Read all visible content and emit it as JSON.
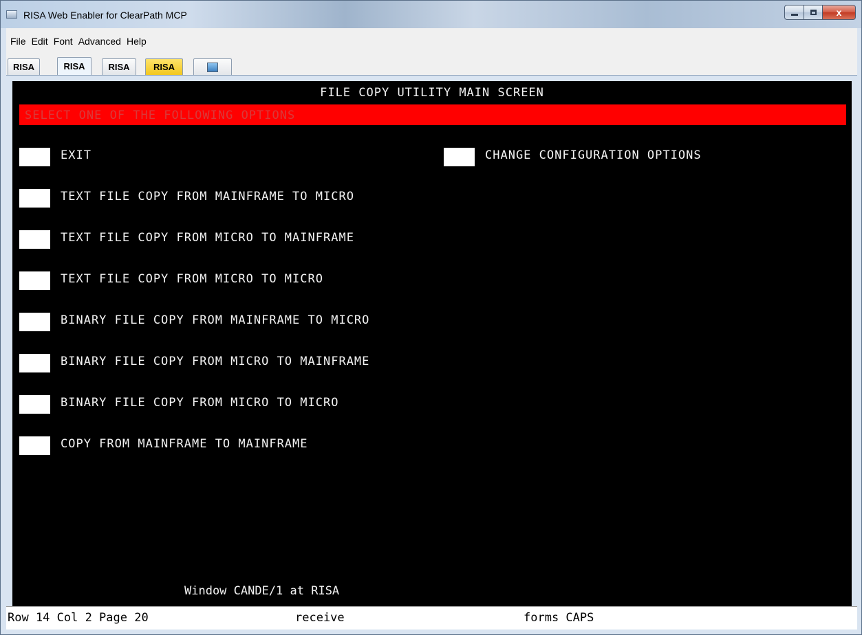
{
  "window": {
    "title": "RISA Web Enabler for ClearPath MCP",
    "close_glyph": "x"
  },
  "menu": {
    "items": [
      "File",
      "Edit",
      "Font",
      "Advanced",
      "Help"
    ]
  },
  "tabs": [
    {
      "label": "RISA",
      "state": "normal"
    },
    {
      "label": "RISA",
      "state": "active"
    },
    {
      "label": "RISA",
      "state": "normal"
    },
    {
      "label": "RISA",
      "state": "highlighted",
      "color": "#f5cc2a"
    },
    {
      "label": "",
      "icon": "terminal-icon"
    }
  ],
  "screen": {
    "title": "FILE COPY UTILITY MAIN SCREEN",
    "prompt": "SELECT ONE OF THE FOLLOWING OPTIONS",
    "options": [
      {
        "label": "EXIT"
      },
      {
        "label": "CHANGE CONFIGURATION OPTIONS"
      },
      {
        "label": "TEXT FILE COPY FROM MAINFRAME TO MICRO"
      },
      {
        "label": "TEXT FILE COPY FROM MICRO TO MAINFRAME"
      },
      {
        "label": "TEXT FILE COPY FROM MICRO TO MICRO"
      },
      {
        "label": "BINARY FILE COPY FROM MAINFRAME TO MICRO"
      },
      {
        "label": "BINARY FILE COPY FROM MICRO TO MAINFRAME"
      },
      {
        "label": "BINARY FILE COPY FROM MICRO TO MICRO"
      },
      {
        "label": "COPY FROM MAINFRAME TO MAINFRAME"
      }
    ],
    "window_line": "Window CANDE/1 at RISA",
    "prompt_bar_color": "#ff0000"
  },
  "status": {
    "position": "Row 14 Col  2 Page 20",
    "mode": "receive",
    "flags": "forms CAPS"
  }
}
